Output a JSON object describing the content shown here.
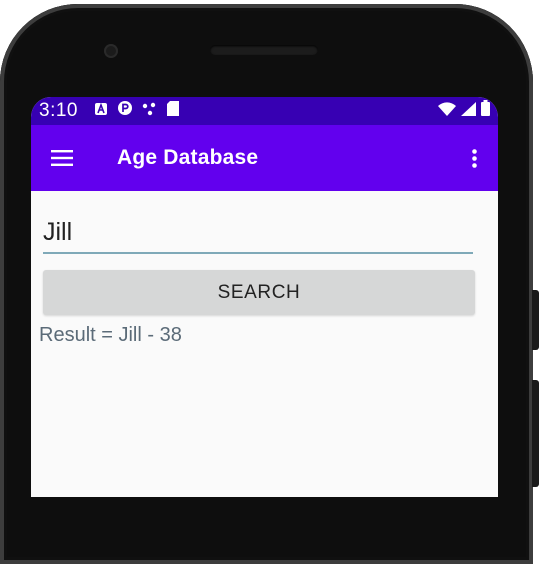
{
  "status_bar": {
    "time": "3:10",
    "notification_icons": [
      "a-badge-icon",
      "p-circle-icon",
      "dots-icon",
      "sd-card-icon"
    ],
    "system_icons": [
      "wifi-icon",
      "signal-icon",
      "battery-icon"
    ]
  },
  "app_bar": {
    "title": "Age Database",
    "menu_icon": "menu-icon",
    "overflow_icon": "more-vert-icon"
  },
  "form": {
    "name_value": "Jill",
    "search_label": "SEARCH",
    "result_text": "Result = Jill - 38"
  },
  "colors": {
    "status_bar": "#3700b3",
    "app_bar": "#6200ee",
    "button_bg": "#d6d7d7",
    "input_underline": "#7fa9b8",
    "result_text": "#5b6b78"
  }
}
